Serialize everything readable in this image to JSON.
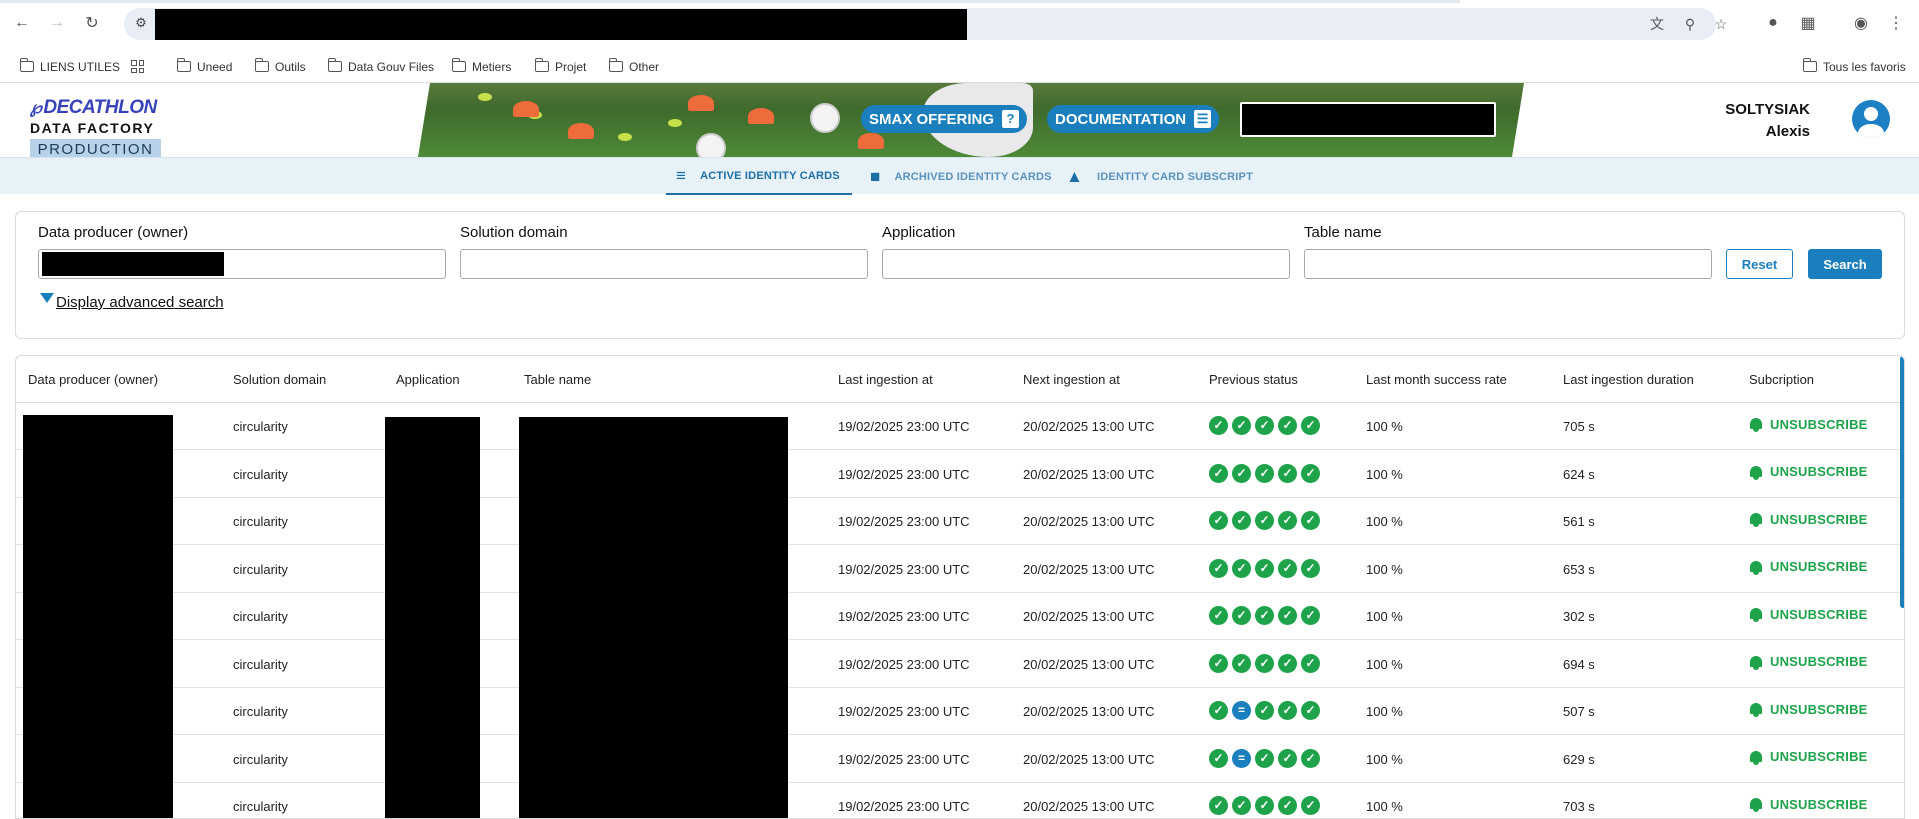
{
  "browser": {
    "bookmarks": [
      {
        "label": "LIENS UTILES",
        "icon": "folder-icon"
      },
      {
        "label": "",
        "icon": "apps-grid-icon"
      },
      {
        "label": "Uneed",
        "icon": "folder-icon"
      },
      {
        "label": "Outils",
        "icon": "folder-icon"
      },
      {
        "label": "Data Gouv Files",
        "icon": "folder-icon"
      },
      {
        "label": "Metiers",
        "icon": "folder-icon"
      },
      {
        "label": "Projet",
        "icon": "folder-icon"
      },
      {
        "label": "Other",
        "icon": "folder-icon"
      }
    ],
    "all_bookmarks": "Tous les favoris"
  },
  "header": {
    "brand": "DECATHLON",
    "product": "DATA FACTORY",
    "environment": "PRODUCTION",
    "smax_label": "SMAX OFFERING",
    "documentation_label": "DOCUMENTATION",
    "user_last": "SOLTYSIAK",
    "user_first": "Alexis"
  },
  "tabs": [
    {
      "label": "ACTIVE IDENTITY CARDS",
      "icon": "checklist-icon",
      "active": true
    },
    {
      "label": "ARCHIVED IDENTITY CARDS",
      "icon": "lock-icon",
      "active": false
    },
    {
      "label": "IDENTITY CARD SUBSCRIPT",
      "icon": "bell-icon",
      "active": false
    }
  ],
  "search": {
    "fields": [
      {
        "label": "Data producer (owner)",
        "value": ""
      },
      {
        "label": "Solution domain",
        "value": ""
      },
      {
        "label": "Application",
        "value": ""
      },
      {
        "label": "Table name",
        "value": ""
      }
    ],
    "reset_label": "Reset",
    "search_label": "Search",
    "advanced_label": "Display advanced search"
  },
  "table": {
    "columns": [
      "Data producer (owner)",
      "Solution domain",
      "Application",
      "Table name",
      "Last ingestion at",
      "Next ingestion at",
      "Previous status",
      "Last month success rate",
      "Last ingestion duration",
      "Subcription"
    ],
    "unsubscribe_label": "UNSUBSCRIBE",
    "rows": [
      {
        "domain": "circularity",
        "last": "19/02/2025 23:00 UTC",
        "next": "20/02/2025 13:00 UTC",
        "status": [
          "ok",
          "ok",
          "ok",
          "ok",
          "ok"
        ],
        "rate": "100 %",
        "duration": "705 s"
      },
      {
        "domain": "circularity",
        "last": "19/02/2025 23:00 UTC",
        "next": "20/02/2025 13:00 UTC",
        "status": [
          "ok",
          "ok",
          "ok",
          "ok",
          "ok"
        ],
        "rate": "100 %",
        "duration": "624 s"
      },
      {
        "domain": "circularity",
        "last": "19/02/2025 23:00 UTC",
        "next": "20/02/2025 13:00 UTC",
        "status": [
          "ok",
          "ok",
          "ok",
          "ok",
          "ok"
        ],
        "rate": "100 %",
        "duration": "561 s"
      },
      {
        "domain": "circularity",
        "last": "19/02/2025 23:00 UTC",
        "next": "20/02/2025 13:00 UTC",
        "status": [
          "ok",
          "ok",
          "ok",
          "ok",
          "ok"
        ],
        "rate": "100 %",
        "duration": "653 s"
      },
      {
        "domain": "circularity",
        "last": "19/02/2025 23:00 UTC",
        "next": "20/02/2025 13:00 UTC",
        "status": [
          "ok",
          "ok",
          "ok",
          "ok",
          "ok"
        ],
        "rate": "100 %",
        "duration": "302 s"
      },
      {
        "domain": "circularity",
        "last": "19/02/2025 23:00 UTC",
        "next": "20/02/2025 13:00 UTC",
        "status": [
          "ok",
          "ok",
          "ok",
          "ok",
          "ok"
        ],
        "rate": "100 %",
        "duration": "694 s"
      },
      {
        "domain": "circularity",
        "last": "19/02/2025 23:00 UTC",
        "next": "20/02/2025 13:00 UTC",
        "status": [
          "ok",
          "eq",
          "ok",
          "ok",
          "ok"
        ],
        "rate": "100 %",
        "duration": "507 s"
      },
      {
        "domain": "circularity",
        "last": "19/02/2025 23:00 UTC",
        "next": "20/02/2025 13:00 UTC",
        "status": [
          "ok",
          "eq",
          "ok",
          "ok",
          "ok"
        ],
        "rate": "100 %",
        "duration": "629 s"
      },
      {
        "domain": "circularity",
        "last": "19/02/2025 23:00 UTC",
        "next": "20/02/2025 13:00 UTC",
        "status": [
          "ok",
          "ok",
          "ok",
          "ok",
          "ok"
        ],
        "rate": "100 %",
        "duration": "703 s"
      }
    ]
  },
  "colors": {
    "primary": "#1b7fbd",
    "success": "#1ea34a",
    "brand": "#3643ba"
  }
}
